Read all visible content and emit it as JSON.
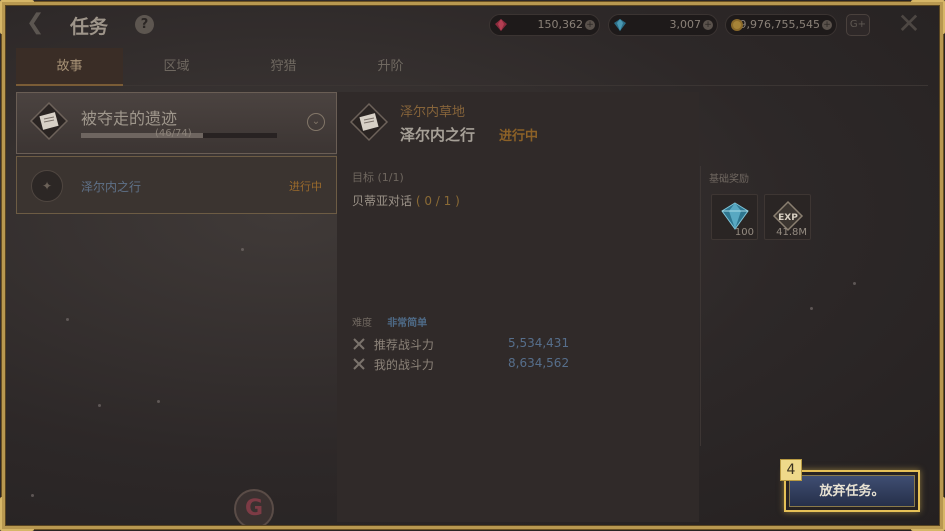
{
  "header": {
    "title": "任务",
    "help_icon": "?",
    "currencies": [
      {
        "name": "ruby",
        "value": "150,362"
      },
      {
        "name": "diamond",
        "value": "3,007"
      },
      {
        "name": "gold",
        "value": "9,976,755,545"
      }
    ],
    "g_button_label": "G+"
  },
  "tabs": [
    {
      "label": "故事",
      "active": true
    },
    {
      "label": "区域",
      "active": false
    },
    {
      "label": "狩猎",
      "active": false
    },
    {
      "label": "升阶",
      "active": false
    }
  ],
  "quest_group": {
    "title": "被夺走的遗迹",
    "progress_text": "(46/74)",
    "progress_fraction": 0.62
  },
  "quest_list": [
    {
      "name": "泽尔内之行",
      "status": "进行中"
    }
  ],
  "detail": {
    "region": "泽尔内草地",
    "name": "泽尔内之行",
    "status": "进行中",
    "objective_label": "目标 (1/1)",
    "objective_text": "贝蒂亚对话",
    "objective_count": "( 0 / 1 )",
    "difficulty_label": "难度",
    "difficulty_value": "非常简单",
    "recommended_power_label": "推荐战斗力",
    "recommended_power_value": "5,534,431",
    "my_power_label": "我的战斗力",
    "my_power_value": "8,634,562"
  },
  "rewards": {
    "title": "基础奖励",
    "items": [
      {
        "icon": "diamond-icon",
        "count": "100"
      },
      {
        "icon": "exp-icon",
        "label": "EXP",
        "count": "41.8M"
      }
    ]
  },
  "bottom": {
    "abandon_label": "放弃任务。",
    "step_badge": "4",
    "logo_letter": "G"
  },
  "colors": {
    "frame_gold": "#b89850",
    "highlight_gold": "#e6c157",
    "status_orange": "#8c6127",
    "power_blue": "#566e8b"
  }
}
